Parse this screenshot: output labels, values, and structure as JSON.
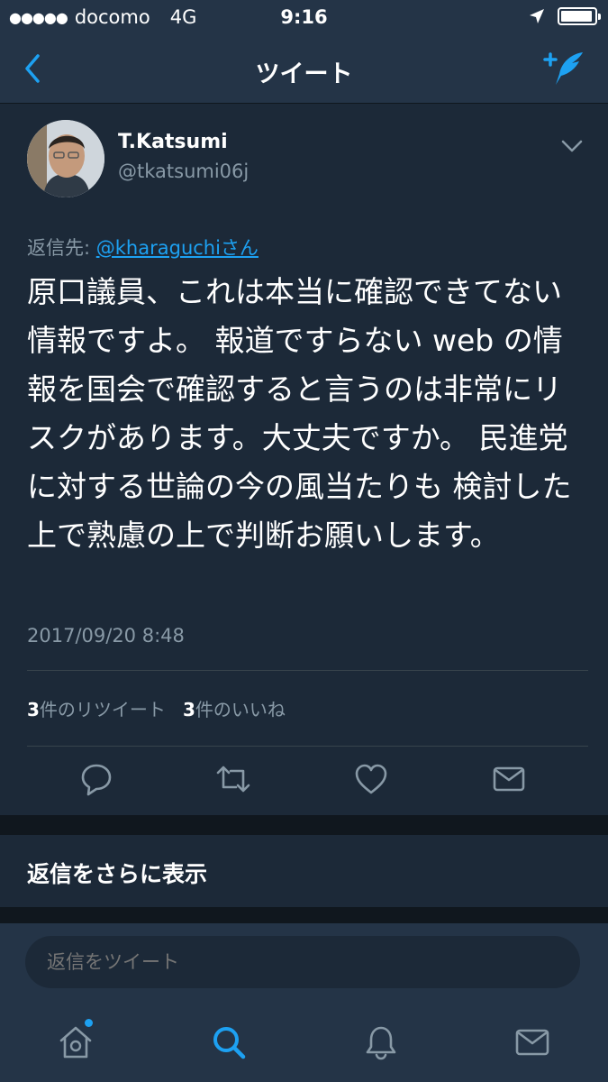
{
  "status_bar": {
    "signal": "●●●●●",
    "carrier": "docomo",
    "network": "4G",
    "time": "9:16"
  },
  "nav": {
    "title": "ツイート"
  },
  "tweet": {
    "display_name": "T.Katsumi",
    "handle": "@tkatsumi06j",
    "reply_prefix": "返信先: ",
    "reply_to": "@kharaguchiさん",
    "text": "原口議員、これは本当に確認できてない情報ですよ。 報道ですらない web の情報を国会で確認すると言うのは非常にリスクがあります。大丈夫ですか。 民進党に対する世論の今の風当たりも 検討した上で熟慮の上で判断お願いします。",
    "timestamp": "2017/09/20 8:48",
    "retweet_count": "3",
    "retweet_label": "件のリツイート",
    "like_count": "3",
    "like_label": "件のいいね"
  },
  "more_replies": "返信をさらに表示",
  "composer": {
    "placeholder": "返信をツイート"
  },
  "colors": {
    "background": "#1c2938",
    "bars": "#243447",
    "accent": "#1da1f2",
    "secondary_text": "#8899a6"
  },
  "icons": {
    "back": "chevron-left-icon",
    "compose": "compose-tweet-icon",
    "caret": "chevron-down-icon",
    "reply": "reply-icon",
    "retweet": "retweet-icon",
    "like": "heart-icon",
    "dm": "mail-icon",
    "home": "home-icon",
    "search": "search-icon",
    "notifications": "bell-icon",
    "messages": "mail-icon"
  }
}
